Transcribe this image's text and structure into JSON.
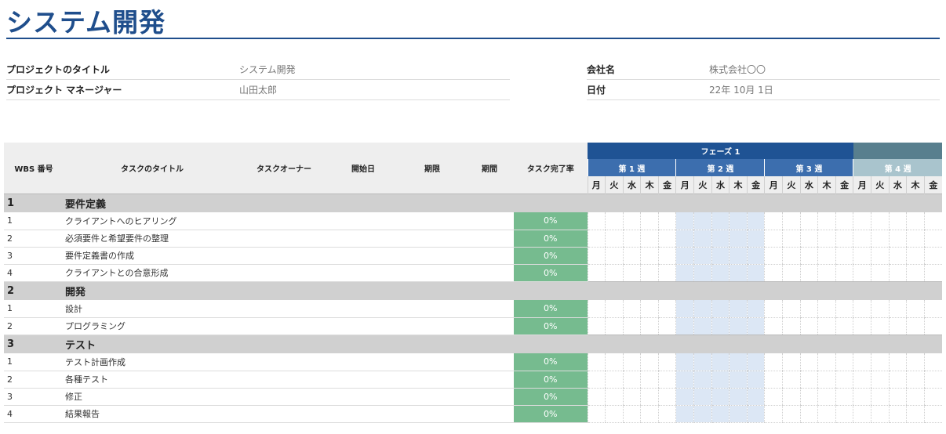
{
  "page": {
    "title": "システム開発"
  },
  "project_info": {
    "left": [
      {
        "label": "プロジェクトのタイトル",
        "value": "システム開発"
      },
      {
        "label": "プロジェクト マネージャー",
        "value": "山田太郎"
      }
    ],
    "right": [
      {
        "label": "会社名",
        "value": "株式会社〇〇"
      },
      {
        "label": "日付",
        "value": "22年 10月 1日"
      }
    ]
  },
  "table": {
    "headers": {
      "wbs": "WBS 番号",
      "task": "タスクのタイトル",
      "owner": "タスクオーナー",
      "start": "開始日",
      "due": "期限",
      "duration": "期間",
      "progress": "タスク完了率"
    },
    "phase": "フェーズ 1",
    "weeks": [
      "第 1 週",
      "第 2 週",
      "第 3 週",
      "第 4 週"
    ],
    "days": [
      "月",
      "火",
      "水",
      "木",
      "金"
    ],
    "categories": [
      {
        "wbs": "1",
        "title": "要件定義",
        "tasks": [
          {
            "wbs": "1",
            "title": "クライアントへのヒアリング",
            "progress": "0%"
          },
          {
            "wbs": "2",
            "title": "必須要件と希望要件の整理",
            "progress": "0%"
          },
          {
            "wbs": "3",
            "title": "要件定義書の作成",
            "progress": "0%"
          },
          {
            "wbs": "4",
            "title": "クライアントとの合意形成",
            "progress": "0%"
          }
        ]
      },
      {
        "wbs": "2",
        "title": "開発",
        "tasks": [
          {
            "wbs": "1",
            "title": "設計",
            "progress": "0%"
          },
          {
            "wbs": "2",
            "title": "プログラミング",
            "progress": "0%"
          }
        ]
      },
      {
        "wbs": "3",
        "title": "テスト",
        "tasks": [
          {
            "wbs": "1",
            "title": "テスト計画作成",
            "progress": "0%"
          },
          {
            "wbs": "2",
            "title": "各種テスト",
            "progress": "0%"
          },
          {
            "wbs": "3",
            "title": "修正",
            "progress": "0%"
          },
          {
            "wbs": "4",
            "title": "結果報告",
            "progress": "0%"
          }
        ]
      }
    ]
  },
  "colors": {
    "title": "#1f4e8c",
    "phase_header": "#1f5394",
    "week_header": "#3c6eae",
    "progress_fill": "#76bb8f",
    "highlight_week": "#dce7f5",
    "category_row": "#d0d0d0"
  }
}
